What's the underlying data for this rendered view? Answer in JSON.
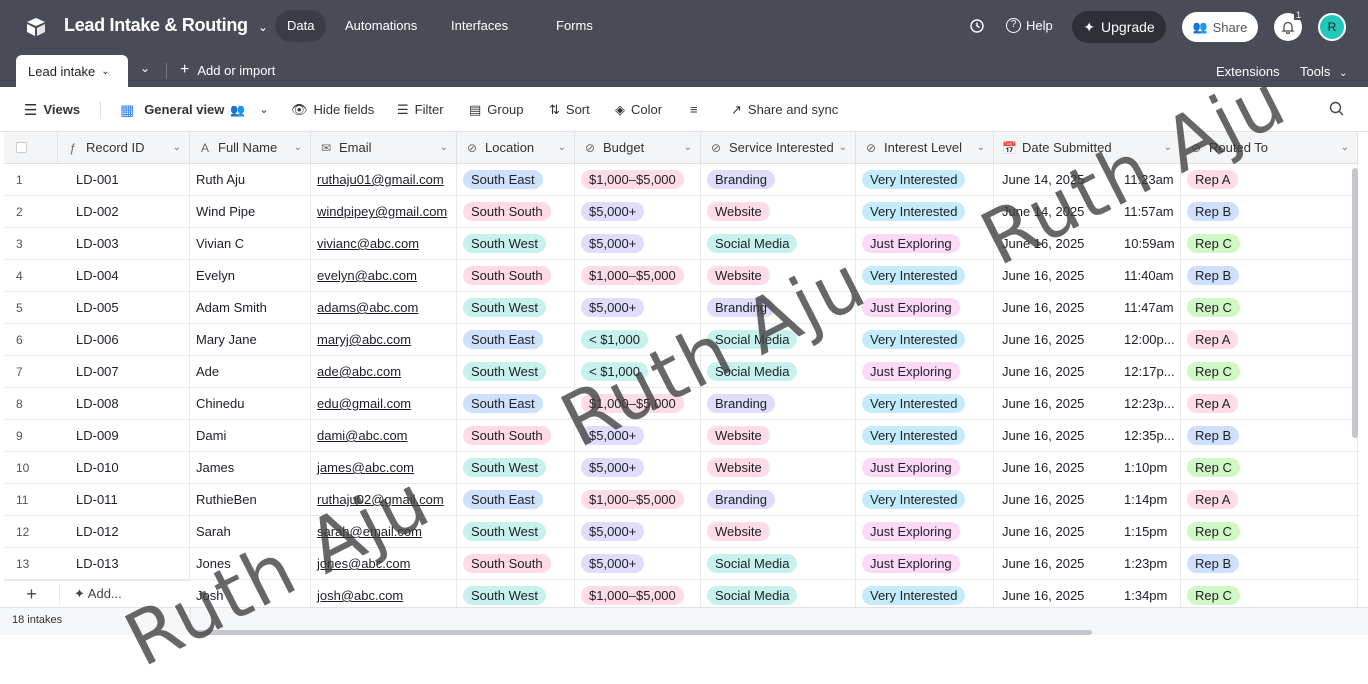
{
  "app": {
    "base_name": "Lead Intake & Routing",
    "nav": [
      "Data",
      "Automations",
      "Interfaces",
      "Forms"
    ],
    "help": "Help",
    "upgrade": "Upgrade",
    "share": "Share",
    "notif_count": "1",
    "avatar": "R"
  },
  "tabs": {
    "active": "Lead intake",
    "add": "Add or import",
    "extensions": "Extensions",
    "tools": "Tools"
  },
  "toolbar": {
    "views": "Views",
    "view_name": "General view",
    "hide": "Hide fields",
    "filter": "Filter",
    "group": "Group",
    "sort": "Sort",
    "color": "Color",
    "share": "Share and sync"
  },
  "columns": [
    "Record ID",
    "Full Name",
    "Email",
    "Location",
    "Budget",
    "Service Interested",
    "Interest Level",
    "Date Submitted",
    "Routed To"
  ],
  "rows": [
    {
      "n": "1",
      "id": "LD-001",
      "name": "Ruth Aju",
      "email": "ruthaju01@gmail.com",
      "loc": "South East",
      "budget": "$1,000–$5,000",
      "service": "Branding",
      "interest": "Very Interested",
      "date": "June 14, 2025",
      "time": "11:23am",
      "rep": "Rep A"
    },
    {
      "n": "2",
      "id": "LD-002",
      "name": "Wind Pipe",
      "email": "windpipey@gmail.com",
      "loc": "South South",
      "budget": "$5,000+",
      "service": "Website",
      "interest": "Very Interested",
      "date": "June 14, 2025",
      "time": "11:57am",
      "rep": "Rep B"
    },
    {
      "n": "3",
      "id": "LD-003",
      "name": "Vivian C",
      "email": "vivianc@abc.com",
      "loc": "South West",
      "budget": "$5,000+",
      "service": "Social Media",
      "interest": "Just Exploring",
      "date": "June 16, 2025",
      "time": "10:59am",
      "rep": "Rep C"
    },
    {
      "n": "4",
      "id": "LD-004",
      "name": "Evelyn",
      "email": "evelyn@abc.com",
      "loc": "South South",
      "budget": "$1,000–$5,000",
      "service": "Website",
      "interest": "Very Interested",
      "date": "June 16, 2025",
      "time": "11:40am",
      "rep": "Rep B"
    },
    {
      "n": "5",
      "id": "LD-005",
      "name": "Adam Smith",
      "email": "adams@abc.com",
      "loc": "South West",
      "budget": "$5,000+",
      "service": "Branding",
      "interest": "Just Exploring",
      "date": "June 16, 2025",
      "time": "11:47am",
      "rep": "Rep C"
    },
    {
      "n": "6",
      "id": "LD-006",
      "name": "Mary Jane",
      "email": "maryj@abc.com",
      "loc": "South East",
      "budget": "< $1,000",
      "service": "Social Media",
      "interest": "Very Interested",
      "date": "June 16, 2025",
      "time": "12:00p...",
      "rep": "Rep A"
    },
    {
      "n": "7",
      "id": "LD-007",
      "name": "Ade",
      "email": "ade@abc.com",
      "loc": "South West",
      "budget": "< $1,000",
      "service": "Social Media",
      "interest": "Just Exploring",
      "date": "June 16, 2025",
      "time": "12:17p...",
      "rep": "Rep C"
    },
    {
      "n": "8",
      "id": "LD-008",
      "name": "Chinedu",
      "email": "edu@gmail.com",
      "loc": "South East",
      "budget": "$1,000–$5,000",
      "service": "Branding",
      "interest": "Very Interested",
      "date": "June 16, 2025",
      "time": "12:23p...",
      "rep": "Rep A"
    },
    {
      "n": "9",
      "id": "LD-009",
      "name": "Dami",
      "email": "dami@abc.com",
      "loc": "South South",
      "budget": "$5,000+",
      "service": "Website",
      "interest": "Very Interested",
      "date": "June 16, 2025",
      "time": "12:35p...",
      "rep": "Rep B"
    },
    {
      "n": "10",
      "id": "LD-010",
      "name": "James",
      "email": "james@abc.com",
      "loc": "South West",
      "budget": "$5,000+",
      "service": "Website",
      "interest": "Just Exploring",
      "date": "June 16, 2025",
      "time": "1:10pm",
      "rep": "Rep C"
    },
    {
      "n": "11",
      "id": "LD-011",
      "name": "RuthieBen",
      "email": "ruthaju02@gmail.com",
      "loc": "South East",
      "budget": "$1,000–$5,000",
      "service": "Branding",
      "interest": "Very Interested",
      "date": "June 16, 2025",
      "time": "1:14pm",
      "rep": "Rep A"
    },
    {
      "n": "12",
      "id": "LD-012",
      "name": "Sarah",
      "email": "sarah@email.com",
      "loc": "South West",
      "budget": "$5,000+",
      "service": "Website",
      "interest": "Just Exploring",
      "date": "June 16, 2025",
      "time": "1:15pm",
      "rep": "Rep C"
    },
    {
      "n": "13",
      "id": "LD-013",
      "name": "Jones",
      "email": "jones@abc.com",
      "loc": "South South",
      "budget": "$5,000+",
      "service": "Social Media",
      "interest": "Just Exploring",
      "date": "June 16, 2025",
      "time": "1:23pm",
      "rep": "Rep B"
    },
    {
      "n": "",
      "id": "",
      "name": "Josh",
      "email": "josh@abc.com",
      "loc": "South West",
      "budget": "$1,000–$5,000",
      "service": "Social Media",
      "interest": "Very Interested",
      "date": "June 16, 2025",
      "time": "1:34pm",
      "rep": "Rep C"
    }
  ],
  "add_row": "Add...",
  "footer": {
    "count": "18 intakes"
  },
  "watermark": "Ruth Aju",
  "colors": {
    "loc": {
      "South East": "#cfe0fc",
      "South South": "#ffdce5",
      "South West": "#c6f1ec"
    },
    "budget": {
      "$1,000–$5,000": "#ffdce5",
      "$5,000+": "#e0dcfc",
      "< $1,000": "#c6f1ec"
    },
    "service": {
      "Branding": "#e0dcfc",
      "Website": "#ffdce5",
      "Social Media": "#c6f1ec"
    },
    "interest": {
      "Very Interested": "#c4ecfb",
      "Just Exploring": "#fcd9f5"
    },
    "rep": {
      "Rep A": "#ffdce5",
      "Rep B": "#cfe0fc",
      "Rep C": "#d1f7c4"
    }
  }
}
